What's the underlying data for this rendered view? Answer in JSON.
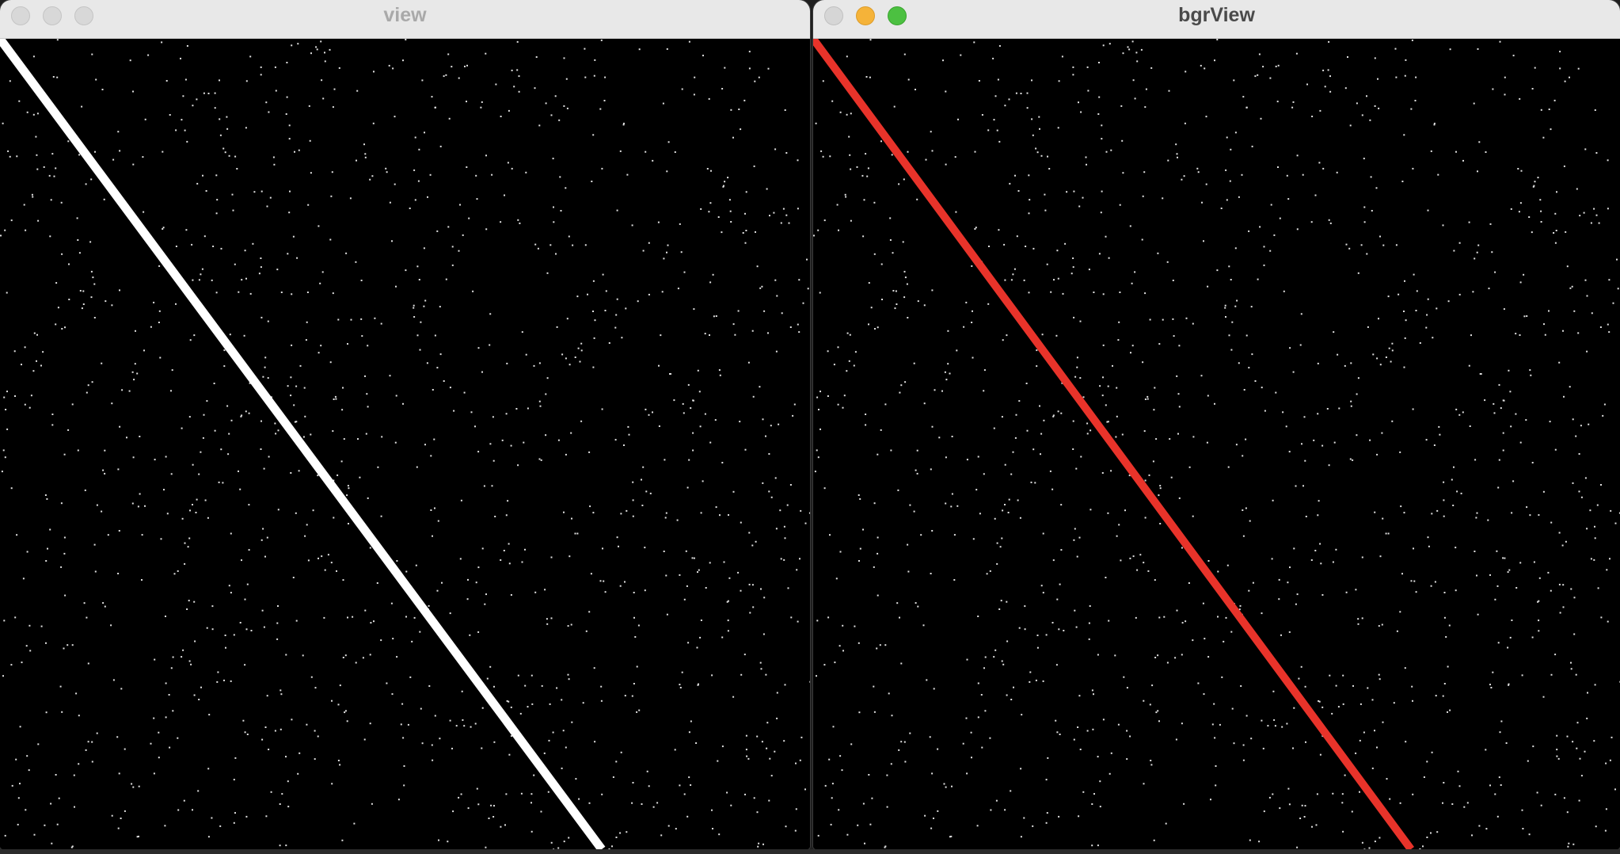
{
  "windows": [
    {
      "id": "view",
      "title": "view",
      "state": "inactive",
      "line_color": "#ffffff",
      "noise_color": "#e0e0e0"
    },
    {
      "id": "bgrView",
      "title": "bgrView",
      "state": "active",
      "line_color": "#e8332a",
      "noise_color": "#e0e0e0"
    }
  ],
  "icons": {
    "close": "close-button-icon",
    "minimize": "minimize-button-icon",
    "zoom": "zoom-button-icon"
  }
}
